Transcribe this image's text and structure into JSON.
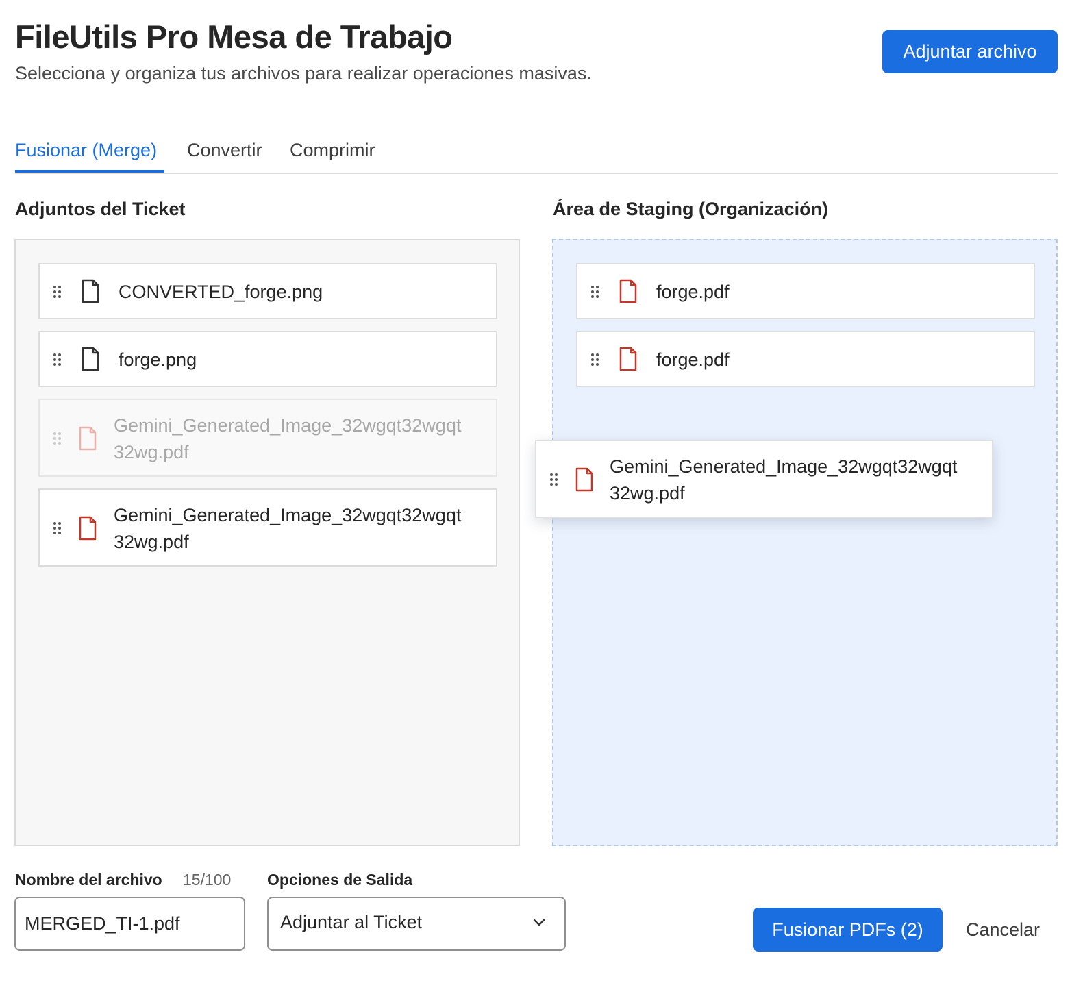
{
  "header": {
    "title": "FileUtils Pro Mesa de Trabajo",
    "subtitle": "Selecciona y organiza tus archivos para realizar operaciones masivas.",
    "attach_button": "Adjuntar archivo"
  },
  "tabs": [
    {
      "label": "Fusionar (Merge)",
      "active": true
    },
    {
      "label": "Convertir",
      "active": false
    },
    {
      "label": "Comprimir",
      "active": false
    }
  ],
  "ticket_attachments": {
    "heading": "Adjuntos del Ticket",
    "items": [
      {
        "name": "CONVERTED_forge.png",
        "icon": "file-icon",
        "state": "normal"
      },
      {
        "name": "forge.png",
        "icon": "file-icon",
        "state": "normal"
      },
      {
        "name": "Gemini_Generated_Image_32wgqt32wgqt",
        "name_line2": "32wg.pdf",
        "icon": "pdf-file-icon",
        "state": "drag-placeholder"
      },
      {
        "name": "Gemini_Generated_Image_32wgqt32wgqt",
        "name_line2": "32wg.pdf",
        "icon": "pdf-file-icon",
        "state": "normal"
      }
    ]
  },
  "staging": {
    "heading": "Área de Staging (Organización)",
    "items": [
      {
        "name": "forge.pdf",
        "icon": "pdf-file-icon"
      },
      {
        "name": "forge.pdf",
        "icon": "pdf-file-icon"
      }
    ]
  },
  "drag_preview": {
    "name": "Gemini_Generated_Image_32wgqt32wgqt",
    "name_line2": "32wg.pdf",
    "icon": "pdf-file-icon"
  },
  "footer": {
    "filename_label": "Nombre del archivo",
    "filename_count": "15/100",
    "filename_value": "MERGED_TI-1.pdf",
    "output_label": "Opciones de Salida",
    "output_value": "Adjuntar al Ticket",
    "merge_button": "Fusionar PDFs (2)",
    "cancel_button": "Cancelar"
  },
  "colors": {
    "accent": "#1a6ee0",
    "pdf_icon": "#c0392b",
    "staging_bg": "#eaf1fe"
  }
}
